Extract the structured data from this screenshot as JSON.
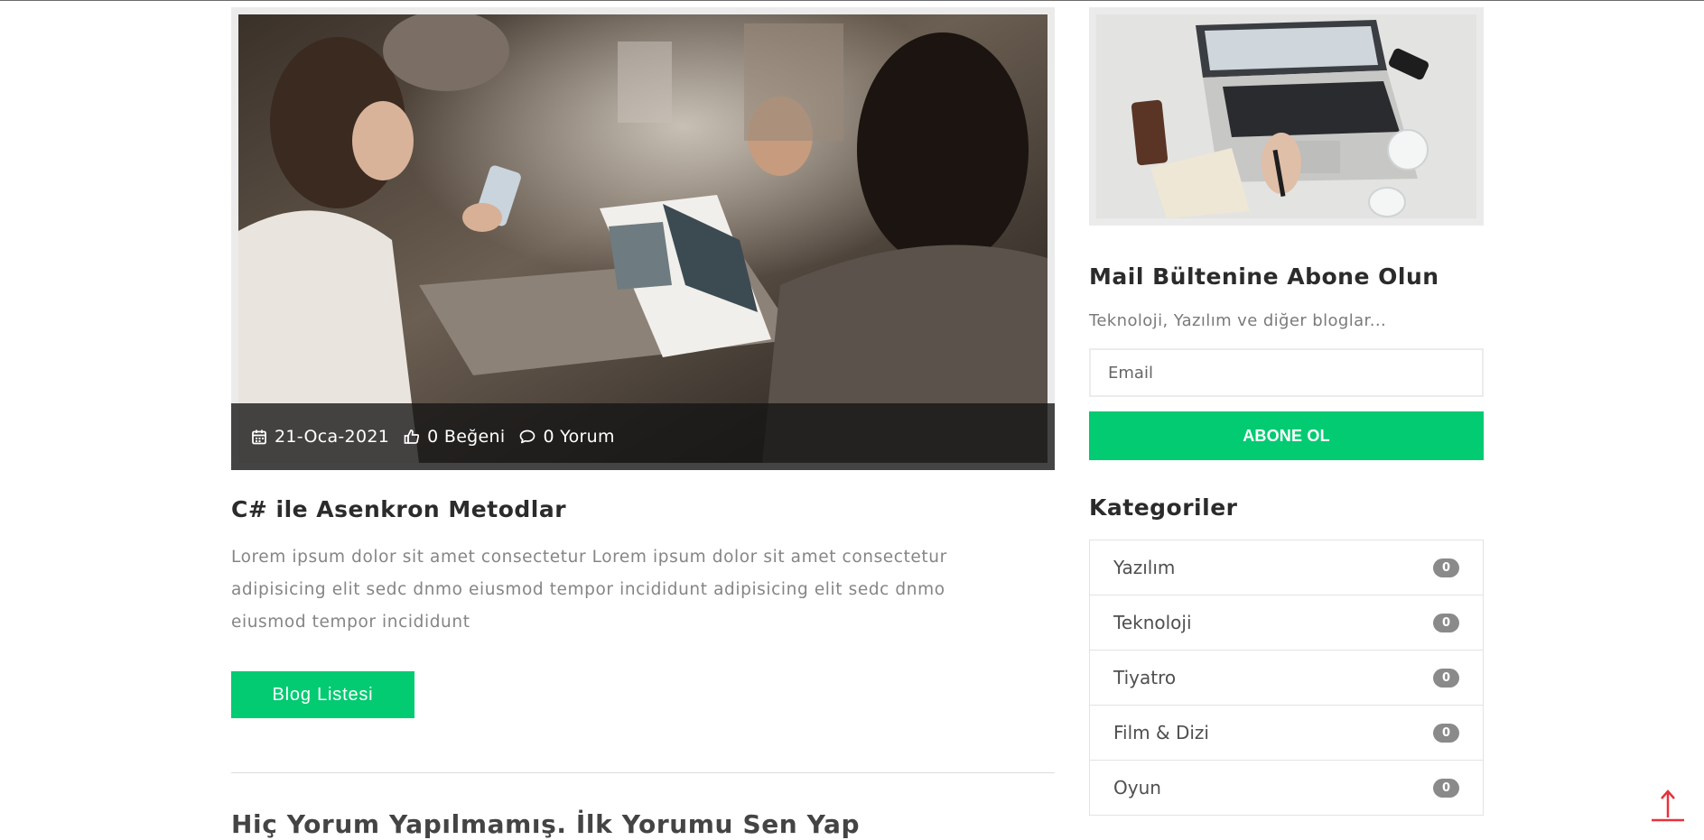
{
  "post": {
    "image_alt": "Group of people reading a magazine and using phones",
    "meta": {
      "date": "21-Oca-2021",
      "likes": "0 Beğeni",
      "comments": "0 Yorum"
    },
    "title": "C# ile Asenkron Metodlar",
    "excerpt": "Lorem ipsum dolor sit amet consectetur Lorem ipsum dolor sit amet consectetur adipisicing elit sedc dnmo eiusmod tempor incididunt adipisicing elit sedc dnmo eiusmod tempor incididunt",
    "button_label": "Blog Listesi"
  },
  "comments": {
    "heading": "Hiç Yorum Yapılmamış. İlk Yorumu Sen Yap"
  },
  "sidebar": {
    "image_alt": "Laptop on a white desk",
    "newsletter": {
      "heading": "Mail Bültenine Abone Olun",
      "description": "Teknoloji, Yazılım ve diğer bloglar...",
      "email_placeholder": "Email",
      "button_label": "ABONE OL"
    },
    "categories": {
      "heading": "Kategoriler",
      "items": [
        {
          "label": "Yazılım",
          "count": "0"
        },
        {
          "label": "Teknoloji",
          "count": "0"
        },
        {
          "label": "Tiyatro",
          "count": "0"
        },
        {
          "label": "Film & Dizi",
          "count": "0"
        },
        {
          "label": "Oyun",
          "count": "0"
        }
      ]
    }
  },
  "colors": {
    "accent": "#02cb72",
    "badge": "#8a8a8a",
    "scroll_top": "#e8313b"
  },
  "icons": {
    "date": "calendar-icon",
    "likes": "thumbs-up-icon",
    "comments": "comment-icon",
    "scroll_top": "arrow-up-icon"
  }
}
